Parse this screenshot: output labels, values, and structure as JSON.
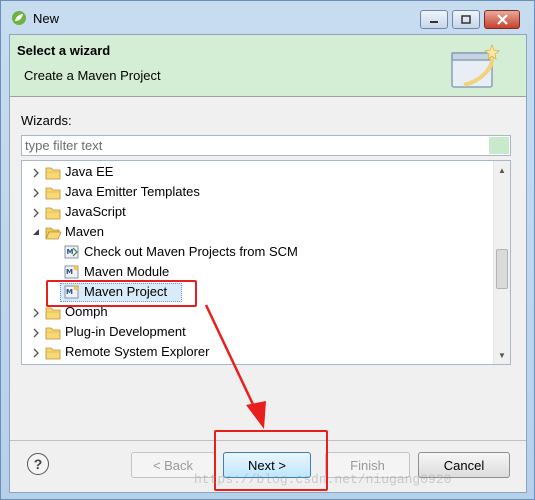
{
  "window": {
    "title": "New"
  },
  "banner": {
    "title": "Select a wizard",
    "description": "Create a Maven Project"
  },
  "wizards_label": "Wizards:",
  "filter": {
    "placeholder": "type filter text",
    "value": ""
  },
  "tree": {
    "items": [
      {
        "label": "Java EE",
        "icon": "folder-icon",
        "expanded": false
      },
      {
        "label": "Java Emitter Templates",
        "icon": "folder-icon",
        "expanded": false
      },
      {
        "label": "JavaScript",
        "icon": "folder-icon",
        "expanded": false
      },
      {
        "label": "Maven",
        "icon": "folder-icon",
        "expanded": true
      },
      {
        "label": "Check out Maven Projects from SCM",
        "icon": "maven-checkout-icon"
      },
      {
        "label": "Maven Module",
        "icon": "maven-module-icon"
      },
      {
        "label": "Maven Project",
        "icon": "maven-project-icon",
        "selected": true
      },
      {
        "label": "Oomph",
        "icon": "folder-icon",
        "expanded": false
      },
      {
        "label": "Plug-in Development",
        "icon": "folder-icon",
        "expanded": false
      },
      {
        "label": "Remote System Explorer",
        "icon": "folder-icon",
        "expanded": false
      }
    ]
  },
  "buttons": {
    "back": "< Back",
    "next": "Next >",
    "finish": "Finish",
    "cancel": "Cancel"
  },
  "watermark": "https://blog.csdn.net/niugang0920",
  "colors": {
    "banner_bg": "#d4eed5",
    "highlight": "#e8201d",
    "selection": "#d9ebf9"
  }
}
